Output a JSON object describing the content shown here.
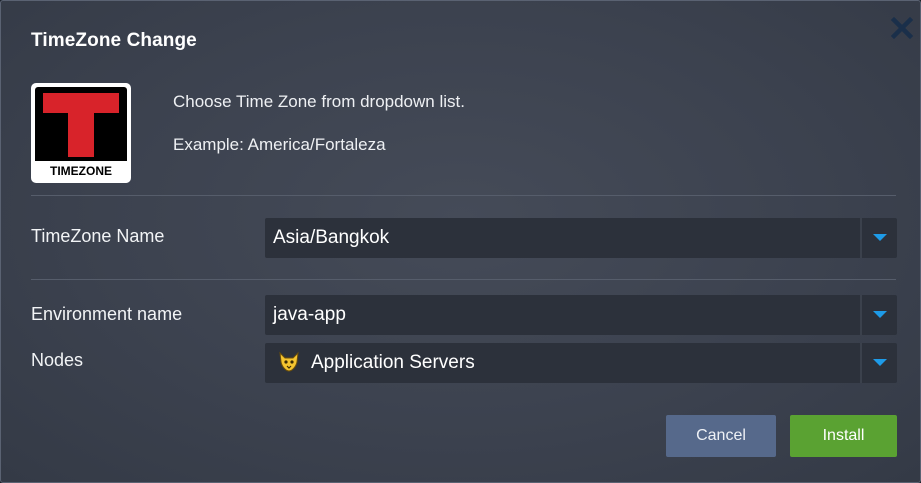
{
  "dialog": {
    "title": "TimeZone Change",
    "close_icon": "close-x-icon"
  },
  "logo": {
    "icon": "timezone-logo",
    "text": "TIMEZONE",
    "colors": {
      "red": "#d8232a",
      "black": "#000000",
      "white": "#ffffff"
    }
  },
  "description": {
    "line1": "Choose Time Zone from dropdown list.",
    "line2": "Example: America/Fortaleza"
  },
  "fields": {
    "timezone": {
      "label": "TimeZone Name",
      "value": "Asia/Bangkok",
      "icon": "chevron-down-icon"
    },
    "environment": {
      "label": "Environment name",
      "value": "java-app",
      "icon": "chevron-down-icon"
    },
    "nodes": {
      "label": "Nodes",
      "value": "Application Servers",
      "node_icon": "tomcat-icon",
      "icon": "chevron-down-icon"
    }
  },
  "buttons": {
    "cancel": "Cancel",
    "install": "Install"
  },
  "colors": {
    "accent": "#1e9be8",
    "install": "#5aa232",
    "cancel": "#56698b",
    "close": "#1a2f4a"
  }
}
